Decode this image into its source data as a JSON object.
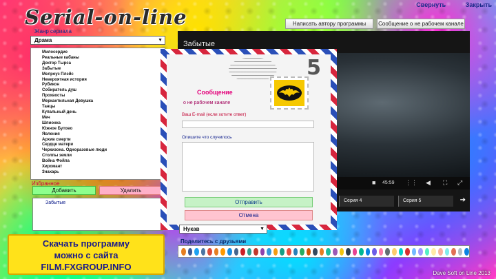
{
  "app": {
    "title": "Serial-on-line",
    "footer": "Dave Soft on Line 2013"
  },
  "top_links": {
    "minimize": "Свернуть",
    "close": "Закрыть"
  },
  "toolbar": {
    "write_author": "Написать автору программы",
    "report_broken": "Сообщение о не рабочем канале"
  },
  "sidebar": {
    "genre_label": "Жанр сериала",
    "genre_value": "Драма",
    "series": [
      "Милосердие",
      "Реальные кабаны",
      "Доктор Тырса",
      "Забытые",
      "Мелроуз Плэйс",
      "Невероятная история",
      "Рубикон",
      "Собиратель душ",
      "Прохвосты",
      "Меркантильная Девушка",
      "Танцы",
      "Купальный день",
      "Меч",
      "Шпионка",
      "Южное Бутово",
      "Явления",
      "Архив смерти",
      "Сердце матери",
      "Черкизона. Одноразовые люди",
      "Столпы земли",
      "Война Фойла",
      "Хиромант",
      "Знахарь"
    ],
    "favorites_label": "Избранное",
    "add_label": "Добавить",
    "delete_label": "Удалить",
    "favorites": [
      "Забытые"
    ]
  },
  "player": {
    "title": "Забытые",
    "time": "45:59",
    "episodes": [
      "Серия 4",
      "Серия 5"
    ]
  },
  "dialog": {
    "title": "Сообщение",
    "subtitle": "о не рабочем канале",
    "email_label": "Ваш E-mail (если хотите ответ)",
    "email_value": "",
    "desc_label": "Опишите что случилось",
    "desc_value": "",
    "send_label": "Отправить",
    "cancel_label": "Отмена",
    "stamp_number": "5"
  },
  "quality": {
    "value": "Нукав"
  },
  "share": {
    "label": "Поделитесь с друзьями",
    "colors": [
      "#e67e22",
      "#3b5998",
      "#1da1f2",
      "#4c75a3",
      "#dd4b39",
      "#e67e22",
      "#ff9900",
      "#168de2",
      "#45668e",
      "#cb2027",
      "#2a9d8f",
      "#c0392b",
      "#8e44ad",
      "#3498db",
      "#f39c12",
      "#16a085",
      "#e74c3c",
      "#2980b9",
      "#27ae60",
      "#d35400",
      "#34495e",
      "#e67e22",
      "#1abc9c",
      "#9b59b6",
      "#f1c40f",
      "#2c3e50",
      "#e84393",
      "#00b894",
      "#0984e3",
      "#6c5ce7",
      "#fd79a8",
      "#636e72",
      "#fdcb6e",
      "#00cec9",
      "#d63031",
      "#74b9ff",
      "#a29bfe",
      "#55efc4",
      "#ffeaa7",
      "#fab1a0",
      "#81ecec",
      "#e17055",
      "#b2bec3",
      "#0984e3"
    ]
  },
  "promo": {
    "line1": "Скачать программу",
    "line2": "можно с сайта",
    "line3": "FILM.FXGROUP.INFO"
  }
}
